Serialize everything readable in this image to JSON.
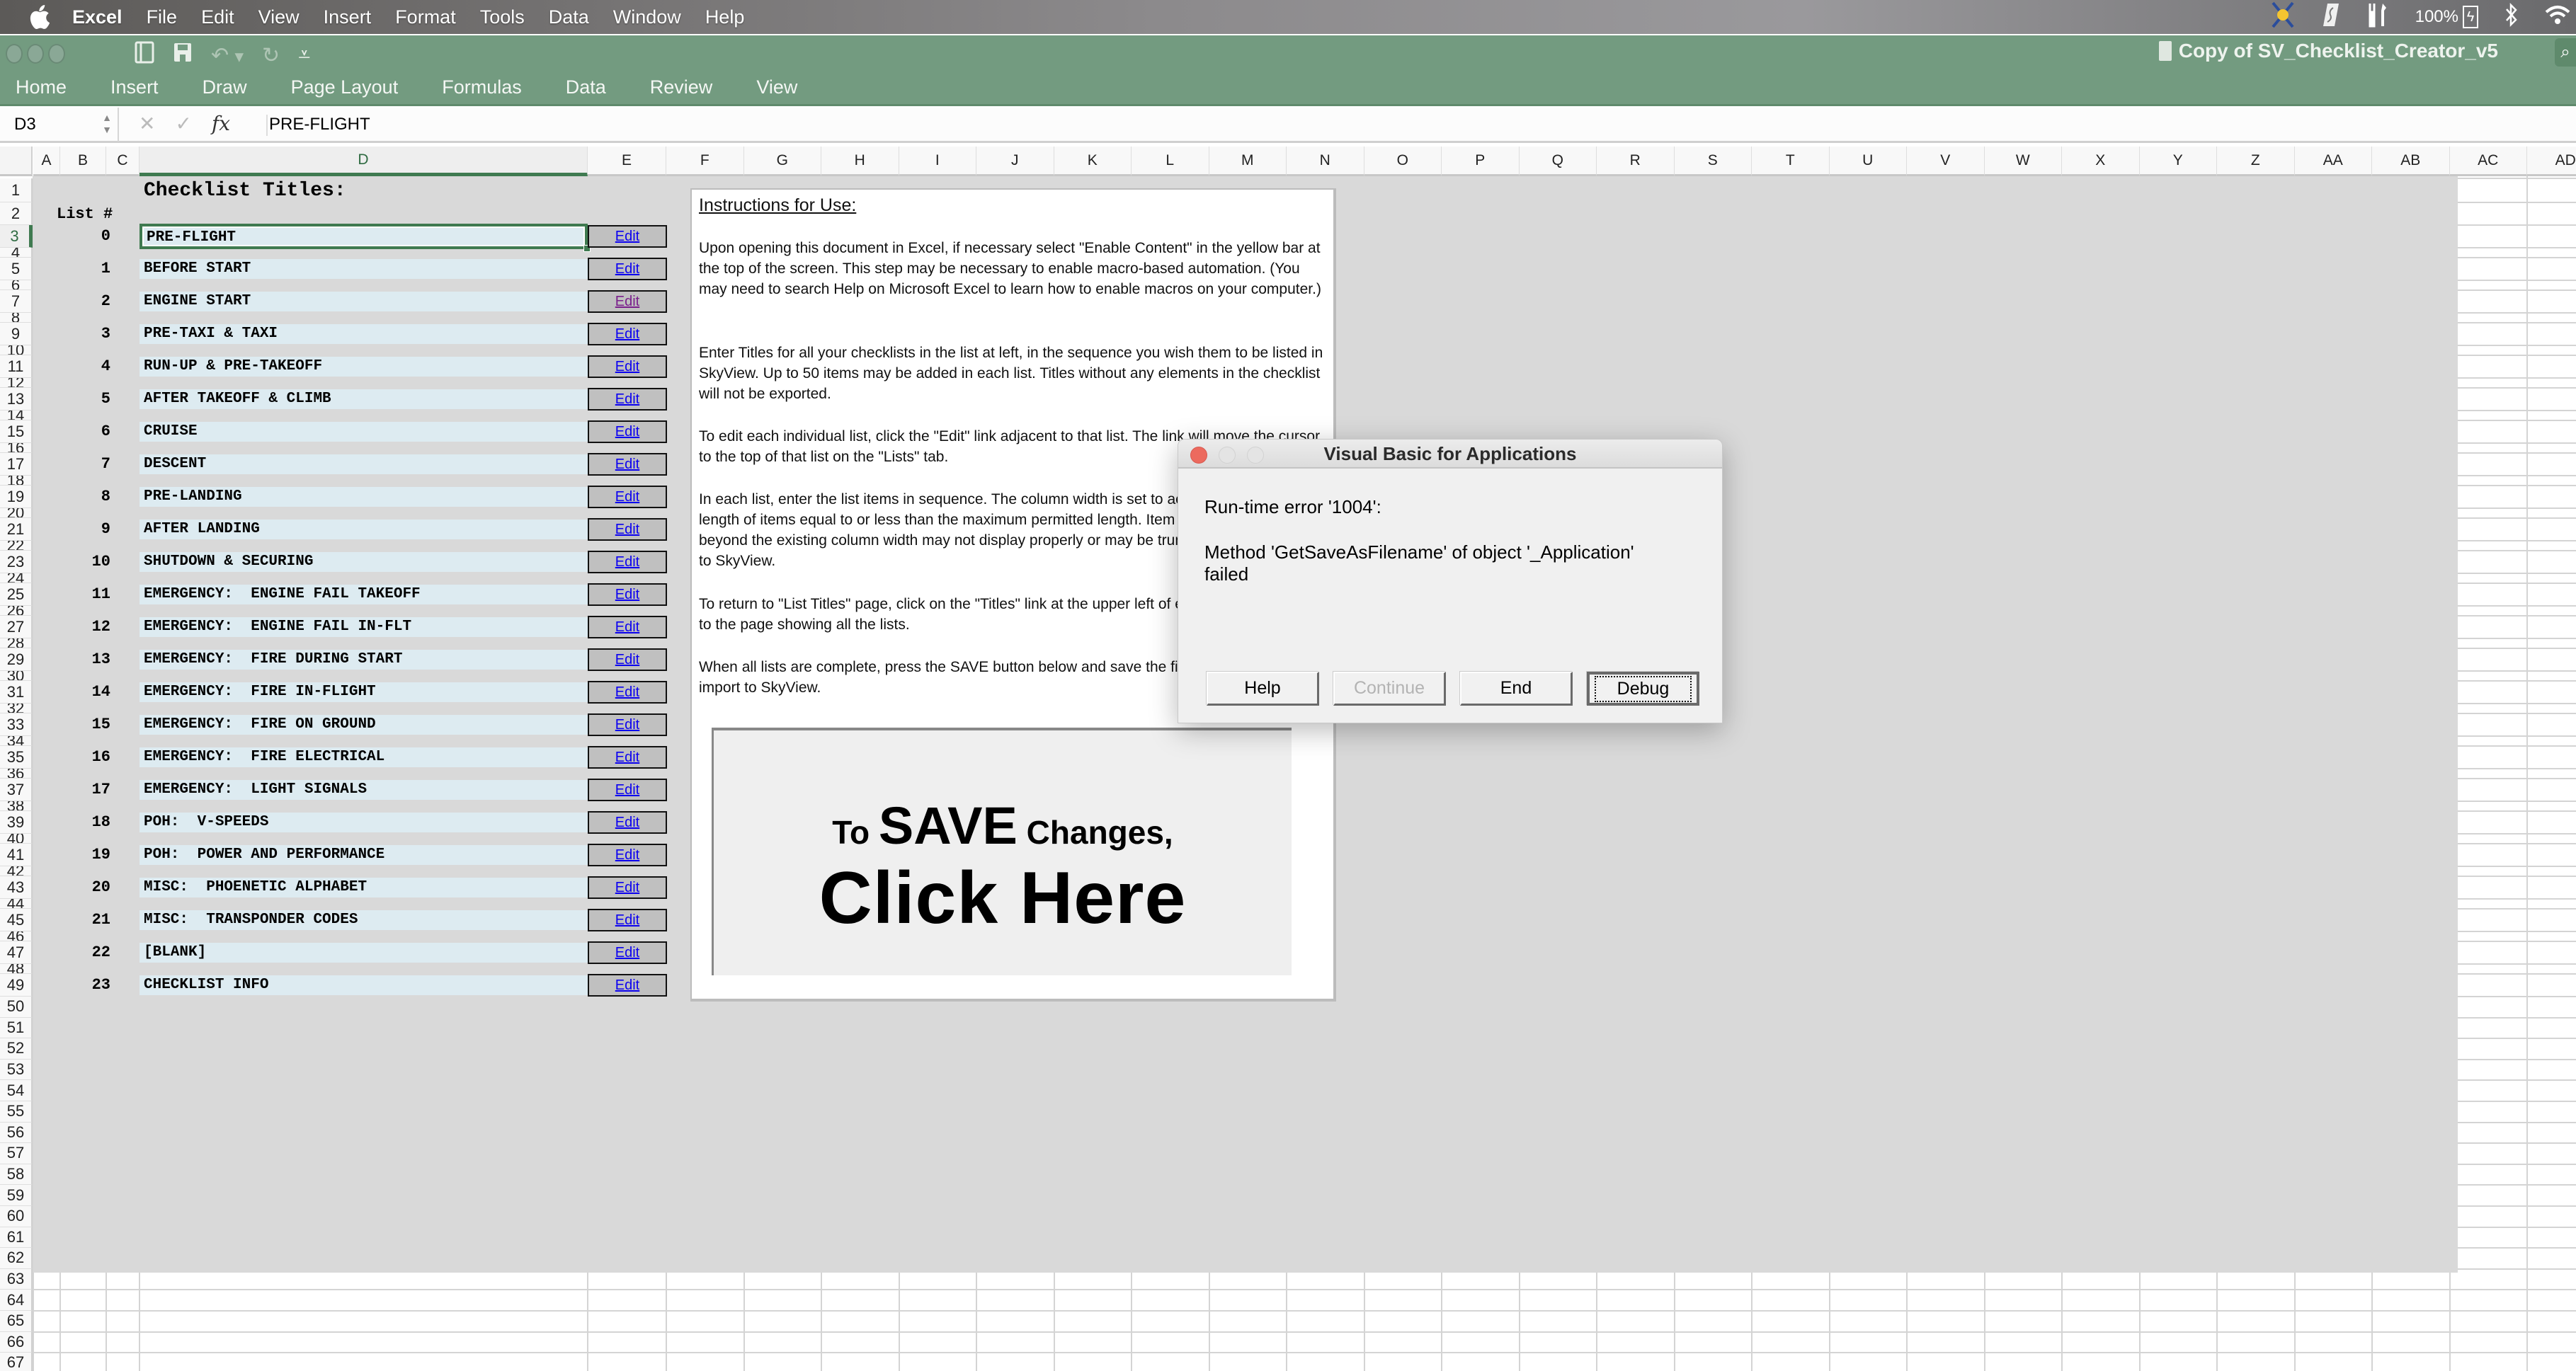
{
  "menubar": {
    "app": "Excel",
    "items": [
      "File",
      "Edit",
      "View",
      "Insert",
      "Format",
      "Tools",
      "Data",
      "Window",
      "Help"
    ],
    "status": {
      "battery_percent": "100%",
      "icons": [
        "vpn-app-icon",
        "scrivener-icon",
        "tools-icon",
        "battery-charging-icon",
        "bluetooth-icon",
        "wifi-icon"
      ]
    }
  },
  "window": {
    "title": "Copy of SV_Checklist_Creator_v5",
    "ribbon_tabs": [
      "Home",
      "Insert",
      "Draw",
      "Page Layout",
      "Formulas",
      "Data",
      "Review",
      "View"
    ]
  },
  "formula_bar": {
    "name_box": "D3",
    "formula": "PRE-FLIGHT",
    "fx_label": "fx"
  },
  "grid": {
    "columns": [
      "A",
      "B",
      "C",
      "D",
      "E",
      "F",
      "G",
      "H",
      "I",
      "J",
      "K",
      "L",
      "M",
      "N",
      "O",
      "P",
      "Q",
      "R",
      "S",
      "T",
      "U",
      "V",
      "W",
      "X",
      "Y",
      "Z",
      "AA",
      "AB",
      "AC",
      "AD"
    ],
    "selected_column": "D",
    "selected_row": "3",
    "rows_visible_last": 67
  },
  "sheet": {
    "heading": "Checklist Titles:",
    "list_number_header": "List #",
    "edit_label": "Edit",
    "lists": [
      {
        "num": "0",
        "title": "PRE-FLIGHT",
        "row": 3
      },
      {
        "num": "1",
        "title": "BEFORE START",
        "row": 5
      },
      {
        "num": "2",
        "title": "ENGINE START",
        "row": 7,
        "visited": true
      },
      {
        "num": "3",
        "title": "PRE-TAXI & TAXI",
        "row": 9
      },
      {
        "num": "4",
        "title": "RUN-UP & PRE-TAKEOFF",
        "row": 11
      },
      {
        "num": "5",
        "title": "AFTER TAKEOFF & CLIMB",
        "row": 13
      },
      {
        "num": "6",
        "title": "CRUISE",
        "row": 15
      },
      {
        "num": "7",
        "title": "DESCENT",
        "row": 17
      },
      {
        "num": "8",
        "title": "PRE-LANDING",
        "row": 19
      },
      {
        "num": "9",
        "title": "AFTER LANDING",
        "row": 21
      },
      {
        "num": "10",
        "title": "SHUTDOWN & SECURING",
        "row": 23
      },
      {
        "num": "11",
        "title": "EMERGENCY:  ENGINE FAIL TAKEOFF",
        "row": 25
      },
      {
        "num": "12",
        "title": "EMERGENCY:  ENGINE FAIL IN-FLT",
        "row": 27
      },
      {
        "num": "13",
        "title": "EMERGENCY:  FIRE DURING START",
        "row": 29
      },
      {
        "num": "14",
        "title": "EMERGENCY:  FIRE IN-FLIGHT",
        "row": 31
      },
      {
        "num": "15",
        "title": "EMERGENCY:  FIRE ON GROUND",
        "row": 33
      },
      {
        "num": "16",
        "title": "EMERGENCY:  FIRE ELECTRICAL",
        "row": 35
      },
      {
        "num": "17",
        "title": "EMERGENCY:  LIGHT SIGNALS",
        "row": 37
      },
      {
        "num": "18",
        "title": "POH:  V-SPEEDS",
        "row": 39
      },
      {
        "num": "19",
        "title": "POH:  POWER AND PERFORMANCE",
        "row": 41
      },
      {
        "num": "20",
        "title": "MISC:  PHOENETIC ALPHABET",
        "row": 43
      },
      {
        "num": "21",
        "title": "MISC:  TRANSPONDER CODES",
        "row": 45
      },
      {
        "num": "22",
        "title": "[BLANK]",
        "row": 47
      },
      {
        "num": "23",
        "title": "CHECKLIST INFO",
        "row": 49
      }
    ]
  },
  "instructions": {
    "title": "Instructions for Use:",
    "paragraphs": [
      "Upon opening this document in Excel, if necessary select \"Enable Content\" in the yellow bar at the top of the screen.  This step may be necessary to enable macro-based automation.  (You may need to search Help on Microsoft Excel to learn how to enable macros on your computer.)",
      "Enter Titles for all your checklists in the list at left, in the sequence you wish them to be listed in SkyView.  Up to 50 items may be added in each list. Titles without any elements in the checklist will not be exported.",
      "To edit each individual list, click the \"Edit\" link adjacent to that list.  The link will move the cursor to the top of that list on the \"Lists\" tab.",
      "In each list, enter the list items in sequence.  The column width is set to accommodate the length of items equal to or less than the maximum permitted length.  Item entries that extend beyond the existing column width may not display properly or may be truncated when imported to SkyView.",
      "To return to \"List Titles\" page, click on the \"Titles\" link at the upper left of each list page to return to the page showing all the lists.",
      "When all lists are complete, press  the SAVE button below and save the file in a location for import to SkyView."
    ],
    "save_button": {
      "line1_pre": "To",
      "line1_big": "SAVE",
      "line1_post": "Changes,",
      "line2": "Click Here"
    }
  },
  "dialog": {
    "title": "Visual Basic for Applications",
    "error": "Run-time error '1004':",
    "message": "Method 'GetSaveAsFilename' of object '_Application' failed",
    "buttons": {
      "help": "Help",
      "continue": "Continue",
      "end": "End",
      "debug": "Debug"
    },
    "continue_enabled": false,
    "default_button": "Debug"
  },
  "colors": {
    "excel_green": "#739b80",
    "selection_green": "#3f7a50",
    "sheet_gray": "#d9d9d9",
    "title_cell_bg": "#ddebf1",
    "edit_button_bg": "#c0c0c0",
    "link_blue": "#0b00f0",
    "link_visited": "#7a1f8c",
    "close_red": "#ec6a5e"
  }
}
